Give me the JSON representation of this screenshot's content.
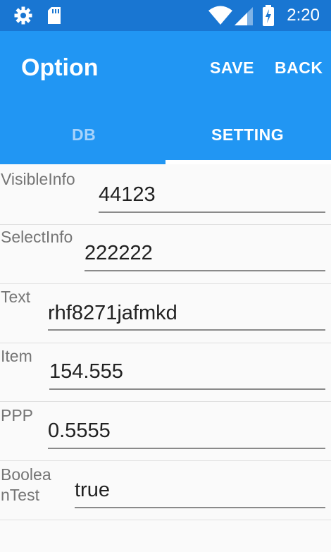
{
  "status_bar": {
    "time": "2:20"
  },
  "appbar": {
    "title": "Option",
    "save_label": "SAVE",
    "back_label": "BACK"
  },
  "tabs": [
    {
      "label": "DB"
    },
    {
      "label": "SETTING"
    }
  ],
  "selected_tab": "SETTING",
  "fields": [
    {
      "label": "VisibleInfo",
      "value": "44123"
    },
    {
      "label": "SelectInfo",
      "value": "222222"
    },
    {
      "label": "Text",
      "value": "rhf8271jafmkd"
    },
    {
      "label": "Item",
      "value": "154.555"
    },
    {
      "label": "PPP",
      "value": "0.5555"
    },
    {
      "label": "BooleanTest",
      "value": "true"
    }
  ],
  "colors": {
    "status_bar": "#1976d2",
    "primary": "#2196f3",
    "tab_inactive": "#a7d3fb"
  }
}
